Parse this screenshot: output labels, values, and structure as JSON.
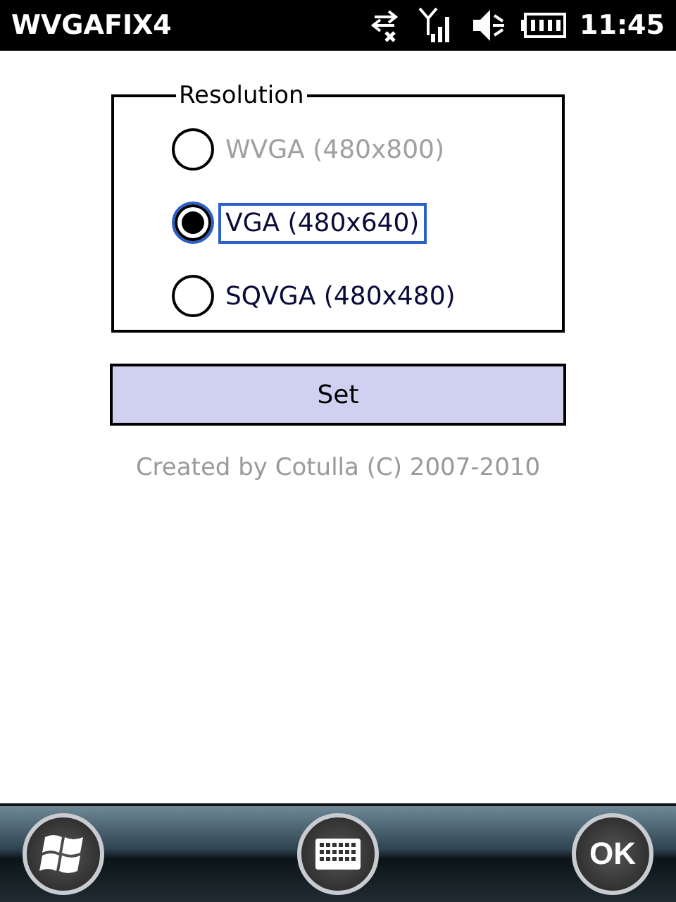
{
  "status_bar": {
    "title": "WVGAFIX4",
    "time": "11:45"
  },
  "group": {
    "legend": "Resolution",
    "options": [
      {
        "label": "WVGA (480x800)",
        "selected": false,
        "disabled": true,
        "focused": false
      },
      {
        "label": "VGA (480x640)",
        "selected": true,
        "disabled": false,
        "focused": true
      },
      {
        "label": "SQVGA (480x480)",
        "selected": false,
        "disabled": false,
        "focused": false
      }
    ]
  },
  "set_button": {
    "label": "Set"
  },
  "credit": "Created by Cotulla (C) 2007-2010",
  "softkeys": {
    "ok": "OK"
  }
}
